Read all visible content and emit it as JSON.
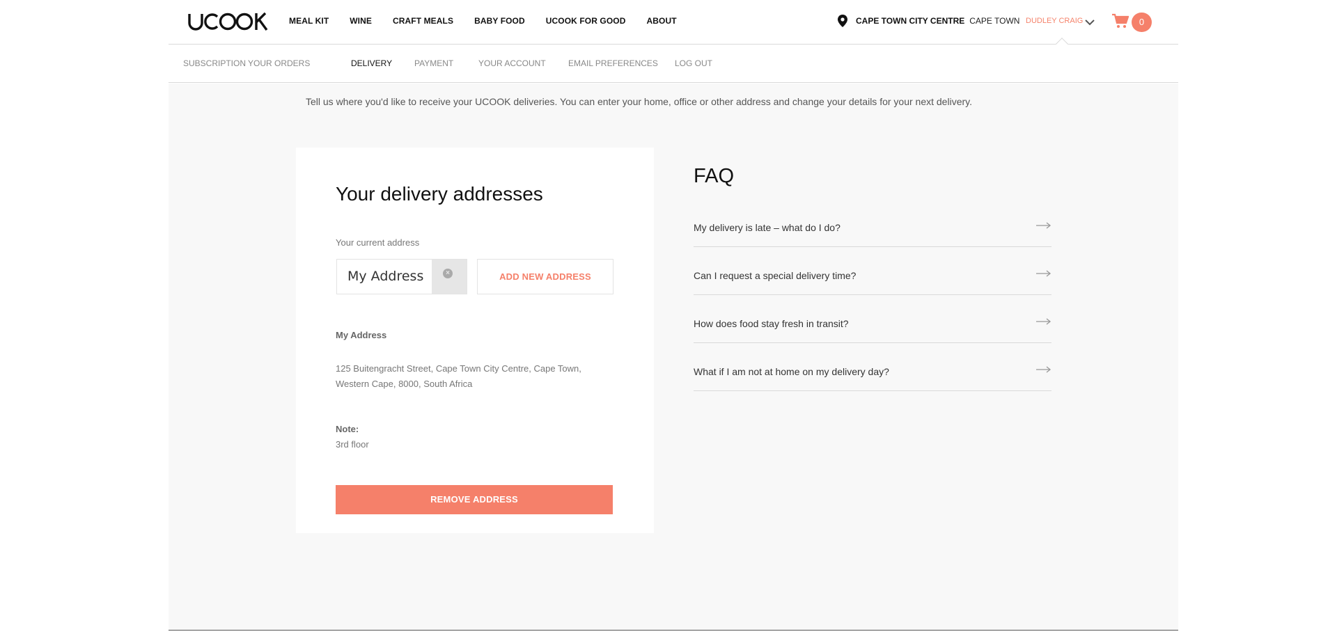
{
  "header": {
    "logo_text": "UCOOK",
    "nav": [
      "MEAL KIT",
      "WINE",
      "CRAFT MEALS",
      "BABY FOOD",
      "UCOOK FOR GOOD",
      "ABOUT"
    ],
    "location_city": "CAPE TOWN CITY CENTRE",
    "location_region": "CAPE TOWN",
    "user_name": "DUDLEY CRAIG",
    "cart_count": "0"
  },
  "subnav": {
    "items": [
      "SUBSCRIPTION",
      "YOUR ORDERS",
      "DELIVERY",
      "PAYMENT",
      "YOUR ACCOUNT",
      "EMAIL PREFERENCES",
      "LOG OUT"
    ],
    "active": "DELIVERY"
  },
  "intro": "Tell us where you'd like to receive your UCOOK deliveries. You can enter your home, office or other address and change your details for your next delivery.",
  "addresses": {
    "heading": "Your delivery addresses",
    "current_label": "Your current address",
    "selected": "My Address",
    "add_button": "ADD NEW ADDRESS",
    "address_name": "My Address",
    "address_line1": "125 Buitengracht Street, Cape Town City Centre, Cape Town,",
    "address_line2": "Western Cape, 8000, South Africa",
    "note_label": "Note:",
    "note_text": "3rd floor",
    "remove_button": "REMOVE ADDRESS"
  },
  "faq": {
    "title": "FAQ",
    "items": [
      "My delivery is late – what do I do?",
      "Can I request a special delivery time?",
      "How does food stay fresh in transit?",
      "What if I am not at home on my delivery day?"
    ]
  },
  "colors": {
    "accent": "#f5806a",
    "background": "#f8f8f8"
  },
  "icons": [
    "location-pin-icon",
    "chevron-down-icon",
    "cart-icon",
    "clear-icon",
    "arrow-right-icon"
  ]
}
